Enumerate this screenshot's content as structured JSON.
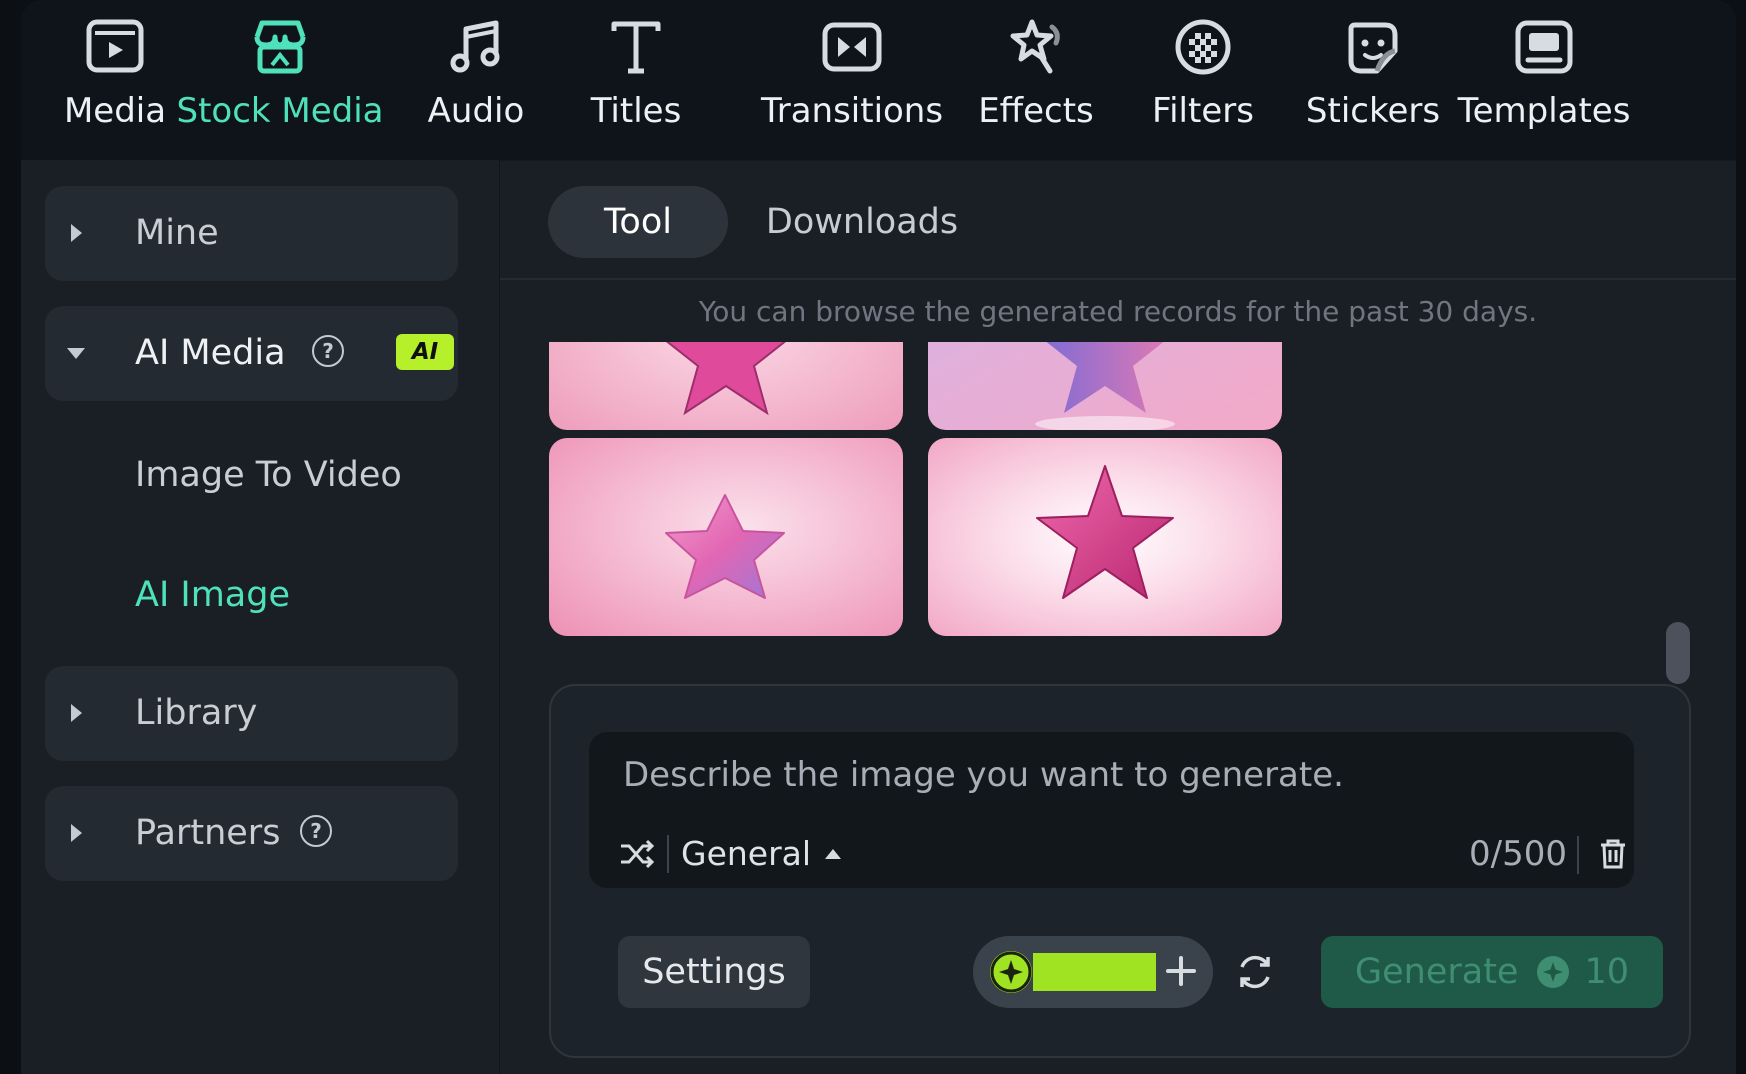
{
  "toolbar": {
    "items": [
      {
        "label": "Media",
        "icon": "media-icon"
      },
      {
        "label": "Stock Media",
        "icon": "stock-media-icon",
        "active": true
      },
      {
        "label": "Audio",
        "icon": "music-note-icon"
      },
      {
        "label": "Titles",
        "icon": "titles-icon"
      },
      {
        "label": "Transitions",
        "icon": "transitions-icon"
      },
      {
        "label": "Effects",
        "icon": "effects-icon"
      },
      {
        "label": "Filters",
        "icon": "filters-icon"
      },
      {
        "label": "Stickers",
        "icon": "stickers-icon"
      },
      {
        "label": "Templates",
        "icon": "templates-icon"
      }
    ],
    "active_color": "#4fe0bc"
  },
  "sidebar": {
    "mine": "Mine",
    "ai_media": "AI Media",
    "ai_badge": "AI",
    "image_to_video": "Image To Video",
    "ai_image": "AI Image",
    "library": "Library",
    "partners": "Partners"
  },
  "tabs": {
    "tool": "Tool",
    "downloads": "Downloads"
  },
  "notice": "You can browse the generated records for the past 30 days.",
  "prompt": {
    "placeholder": "Describe the image you want to generate.",
    "style": "General",
    "counter": "0/500"
  },
  "actions": {
    "settings": "Settings",
    "generate": "Generate",
    "generate_cost": "10"
  },
  "colors": {
    "accent": "#4fe0bc",
    "ai_badge": "#b6f02a",
    "credit_green": "#a0e322",
    "generate_bg": "#1e5a47"
  }
}
